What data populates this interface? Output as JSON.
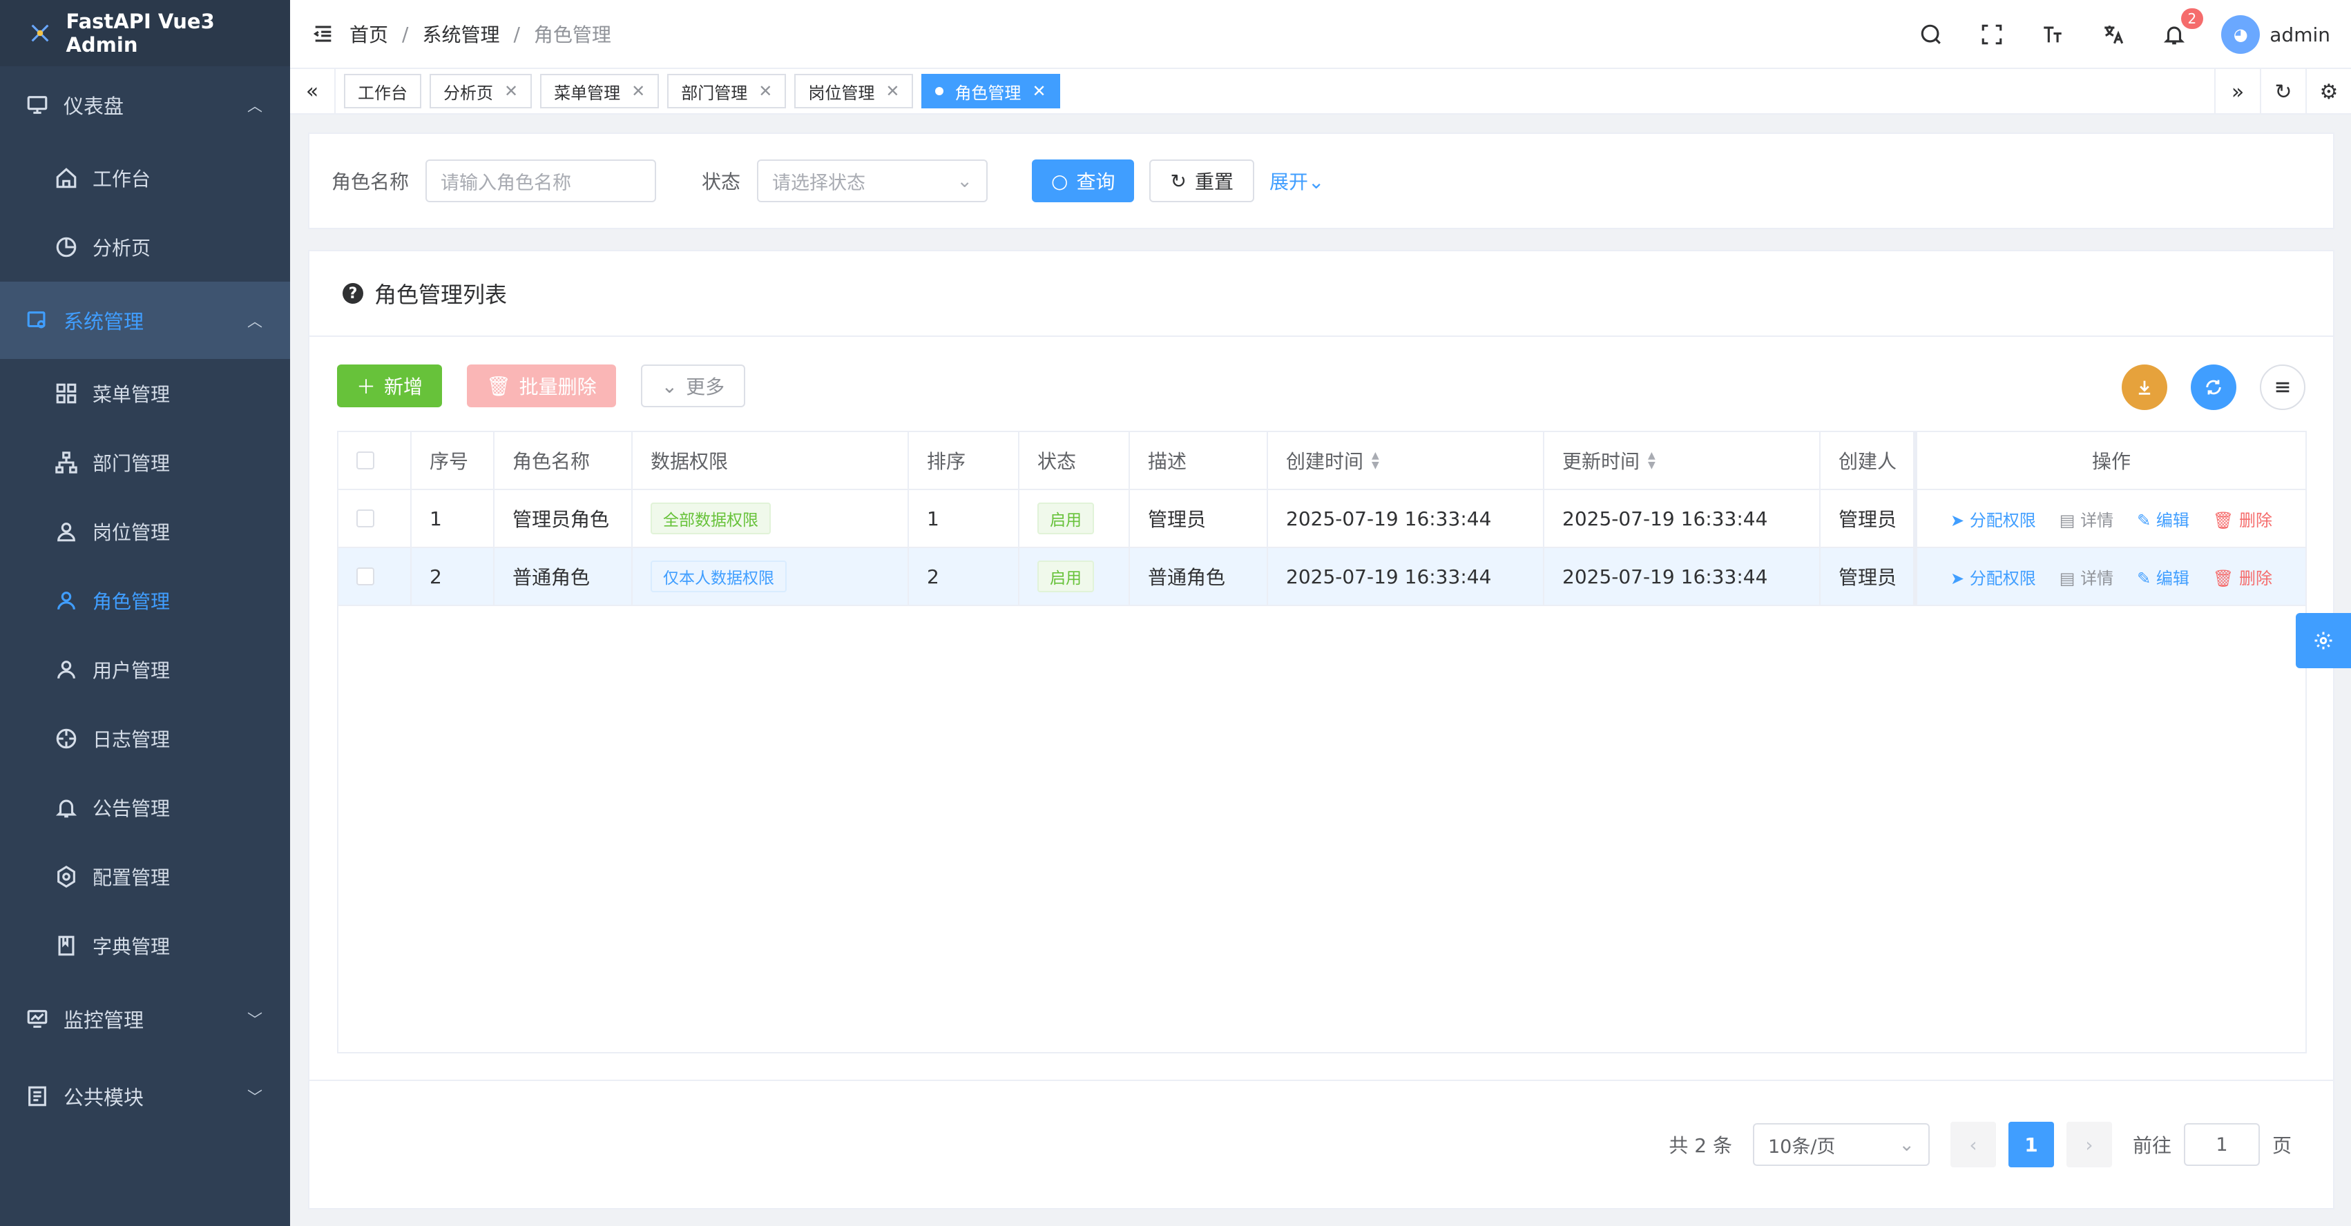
{
  "app": {
    "title": "FastAPI Vue3 Admin"
  },
  "sidebar": {
    "dashboard": {
      "label": "仪表盘",
      "items": [
        {
          "label": "工作台"
        },
        {
          "label": "分析页"
        }
      ]
    },
    "system": {
      "label": "系统管理",
      "items": [
        {
          "label": "菜单管理"
        },
        {
          "label": "部门管理"
        },
        {
          "label": "岗位管理"
        },
        {
          "label": "角色管理"
        },
        {
          "label": "用户管理"
        },
        {
          "label": "日志管理"
        },
        {
          "label": "公告管理"
        },
        {
          "label": "配置管理"
        },
        {
          "label": "字典管理"
        }
      ]
    },
    "monitor": {
      "label": "监控管理"
    },
    "common": {
      "label": "公共模块"
    }
  },
  "breadcrumb": {
    "home": "首页",
    "sep": "/",
    "section": "系统管理",
    "current": "角色管理"
  },
  "header": {
    "notification_count": "2",
    "username": "admin"
  },
  "tabs": [
    {
      "label": "工作台"
    },
    {
      "label": "分析页"
    },
    {
      "label": "菜单管理"
    },
    {
      "label": "部门管理"
    },
    {
      "label": "岗位管理"
    },
    {
      "label": "角色管理"
    }
  ],
  "search": {
    "role_name_label": "角色名称",
    "role_name_placeholder": "请输入角色名称",
    "status_label": "状态",
    "status_placeholder": "请选择状态",
    "query": "查询",
    "reset": "重置",
    "expand": "展开"
  },
  "card": {
    "title": "角色管理列表"
  },
  "toolbar": {
    "add": "新增",
    "batch_delete": "批量删除",
    "more": "更多"
  },
  "table": {
    "columns": [
      "序号",
      "角色名称",
      "数据权限",
      "排序",
      "状态",
      "描述",
      "创建时间",
      "更新时间",
      "创建人",
      "操作"
    ],
    "rows": [
      {
        "index": "1",
        "name": "管理员角色",
        "scope": "全部数据权限",
        "order": "1",
        "status": "启用",
        "desc": "管理员",
        "created": "2025-07-19 16:33:44",
        "updated": "2025-07-19 16:33:44",
        "creator": "管理员"
      },
      {
        "index": "2",
        "name": "普通角色",
        "scope": "仅本人数据权限",
        "order": "2",
        "status": "启用",
        "desc": "普通角色",
        "created": "2025-07-19 16:33:44",
        "updated": "2025-07-19 16:33:44",
        "creator": "管理员"
      }
    ],
    "ops": {
      "assign": "分配权限",
      "detail": "详情",
      "edit": "编辑",
      "delete": "删除"
    }
  },
  "pagination": {
    "total": "共 2 条",
    "page_size": "10条/页",
    "current": "1",
    "goto_label": "前往",
    "goto_value": "1",
    "page_unit": "页"
  },
  "colors": {
    "primary": "#409eff",
    "success": "#67c23a",
    "warning": "#e6a23c",
    "danger": "#f56c6c",
    "sidebar": "#2f3f54"
  }
}
